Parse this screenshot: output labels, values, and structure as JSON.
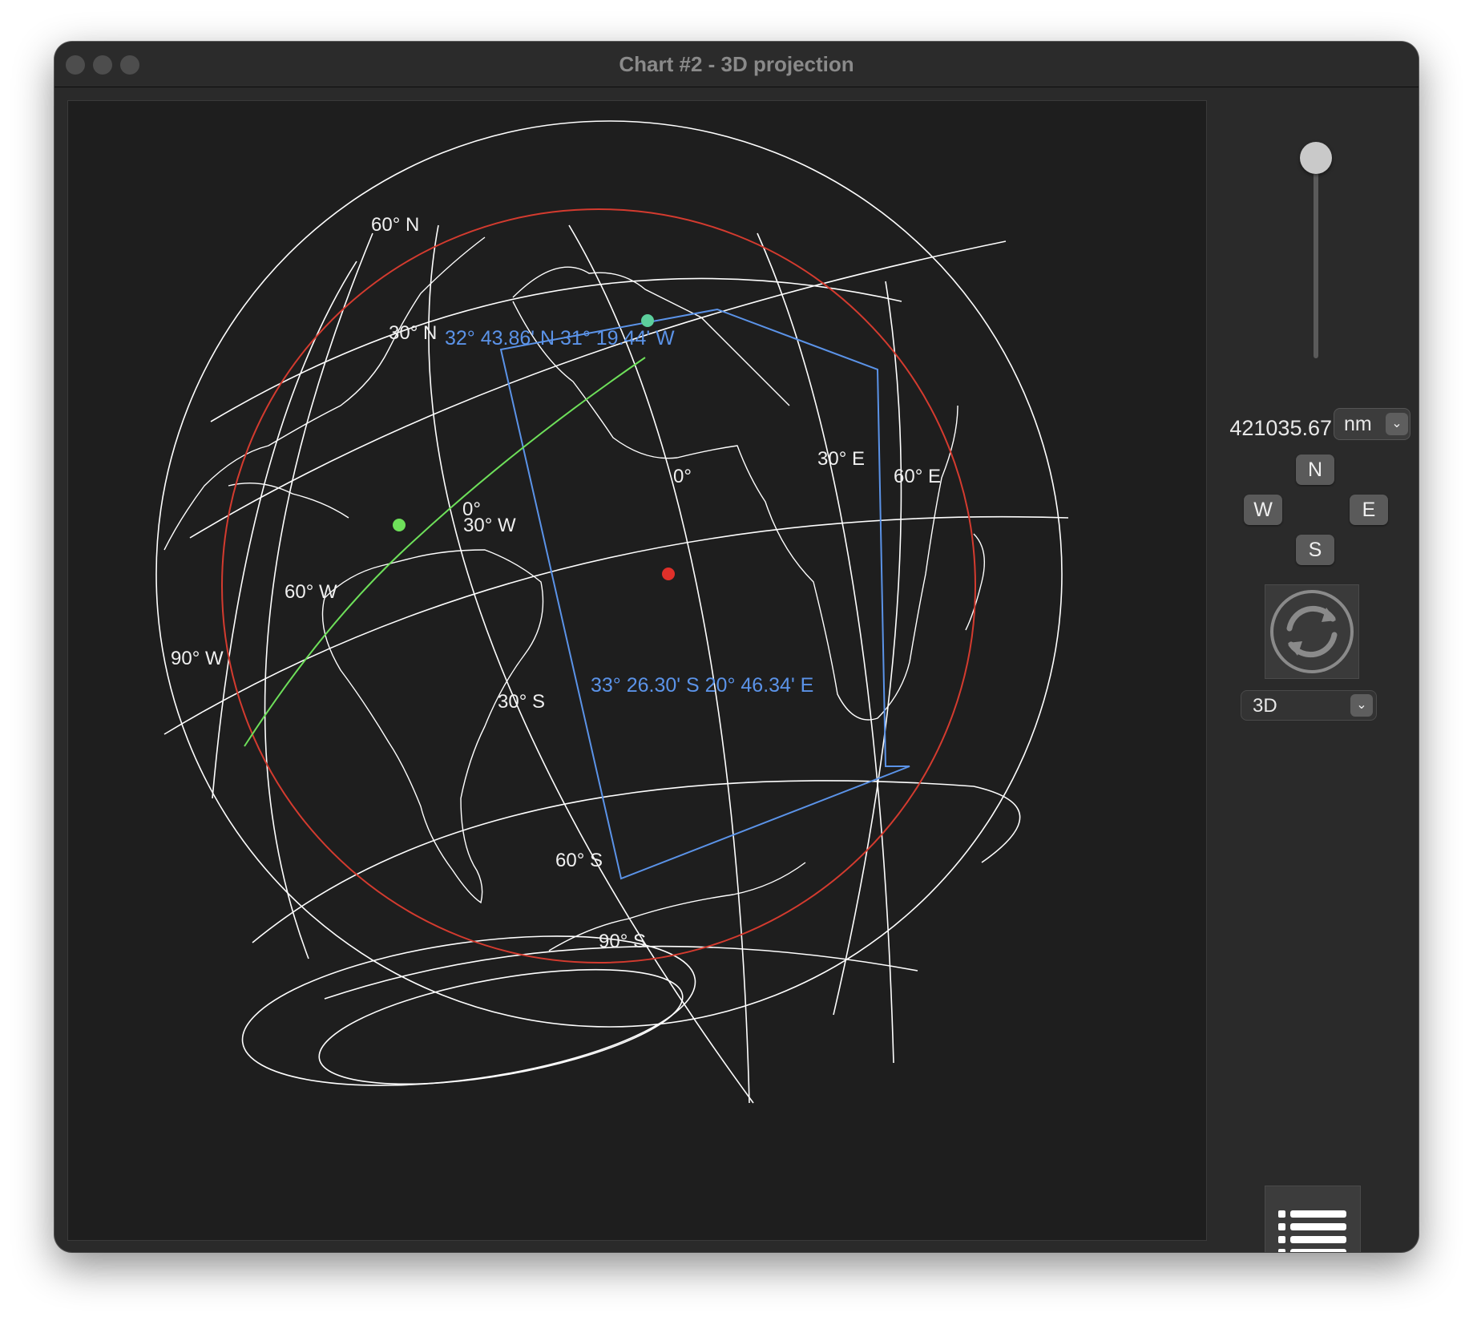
{
  "window": {
    "title": "Chart #2 - 3D projection"
  },
  "chart": {
    "graticule_labels": {
      "lat_60n": "60° N",
      "lat_30n": "30° N",
      "lat_0": "0°",
      "lat_30s": "30° S",
      "lat_60s": "60° S",
      "lat_90s": "90° S",
      "lon_90w": "90° W",
      "lon_60w": "60° W",
      "lon_30w": "30° W",
      "lon_0": "0°",
      "lon_30e": "30° E",
      "lon_60e": "60° E"
    },
    "box_corner_nw": "32° 43.86' N  31° 19.44' W",
    "box_corner_se": "33° 26.30' S  20° 46.34' E",
    "colors": {
      "graticule": "#ffffff",
      "coastline": "#ffffff",
      "horizon_circle": "#d43b2f",
      "selection_box": "#5b93e8",
      "route_start": "#6ee05a",
      "route_end": "#5ccf9c",
      "center_point": "#e0302a"
    }
  },
  "controls": {
    "distance_value": "421035.67",
    "distance_unit": "nm",
    "buttons": {
      "north": "N",
      "west": "W",
      "east": "E",
      "south": "S"
    },
    "projection_mode": "3D",
    "icons": {
      "rotate": "rotate-icon",
      "list": "list-icon",
      "chevron": "chevron-down-icon"
    }
  }
}
